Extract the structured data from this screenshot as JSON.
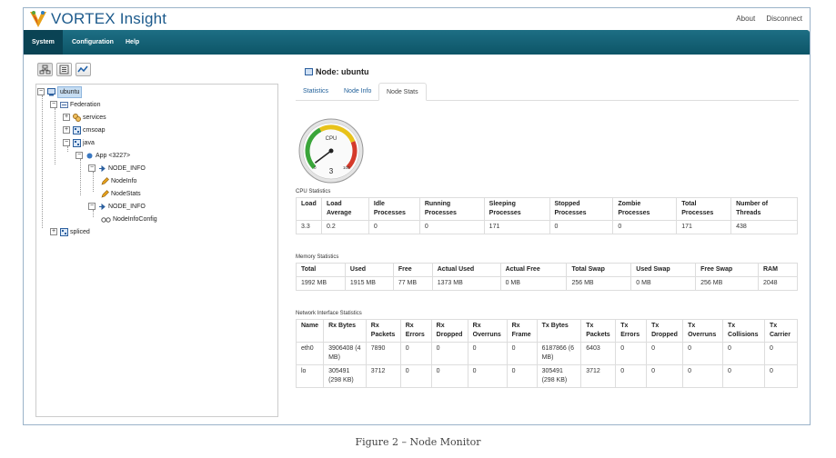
{
  "app": {
    "name": "VORTEX Insight"
  },
  "header": {
    "links": [
      "About",
      "Disconnect"
    ]
  },
  "nav": {
    "items": [
      "System",
      "Configuration",
      "Help"
    ],
    "active": "System"
  },
  "tree_toolbar": {
    "buttons": [
      "tree-view-icon",
      "list-view-icon",
      "chart-view-icon"
    ]
  },
  "tree": {
    "nodes": [
      {
        "label": "ubuntu",
        "icon": "computer-icon",
        "toggle": "−",
        "selected": true
      },
      {
        "label": "Federation",
        "icon": "federation-icon",
        "toggle": "−"
      },
      {
        "label": "services",
        "icon": "services-icon",
        "toggle": "+"
      },
      {
        "label": "cmsoap",
        "icon": "process-icon",
        "toggle": "+"
      },
      {
        "label": "java",
        "icon": "process-icon",
        "toggle": "−"
      },
      {
        "label": "App <3227>",
        "icon": "app-icon",
        "toggle": "−"
      },
      {
        "label": "NODE_INFO",
        "icon": "topic-icon",
        "toggle": "−"
      },
      {
        "label": "NodeInfo",
        "icon": "pencil-icon",
        "toggle": ""
      },
      {
        "label": "NodeStats",
        "icon": "pencil-icon",
        "toggle": ""
      },
      {
        "label": "NODE_INFO",
        "icon": "topic-icon",
        "toggle": "−"
      },
      {
        "label": "NodeInfoConfig",
        "icon": "glasses-icon",
        "toggle": ""
      },
      {
        "label": "spliced",
        "icon": "process-icon",
        "toggle": "+"
      }
    ]
  },
  "main": {
    "title": "Node: ubuntu",
    "tabs": [
      "Statistics",
      "Node Info",
      "Node Stats"
    ],
    "active_tab": "Node Stats",
    "gauge": {
      "label": "CPU",
      "value": "3",
      "min_label": "0",
      "max_label": "100",
      "level": 3
    },
    "cpu": {
      "label": "CPU Statistics",
      "headers": [
        "Load",
        "Load Average",
        "Idle Processes",
        "Running Processes",
        "Sleeping Processes",
        "Stopped Processes",
        "Zombie Processes",
        "Total Processes",
        "Number of Threads"
      ],
      "rows": [
        [
          "3.3",
          "0.2",
          "0",
          "0",
          "171",
          "0",
          "0",
          "171",
          "438"
        ]
      ]
    },
    "memory": {
      "label": "Memory Statistics",
      "headers": [
        "Total",
        "Used",
        "Free",
        "Actual Used",
        "Actual Free",
        "Total Swap",
        "Used Swap",
        "Free Swap",
        "RAM"
      ],
      "rows": [
        [
          "1992 MB",
          "1915 MB",
          "77 MB",
          "1373 MB",
          "0 MB",
          "256 MB",
          "0 MB",
          "256 MB",
          "2048"
        ]
      ]
    },
    "network": {
      "label": "Network Interface Statistics",
      "headers": [
        "Name",
        "Rx Bytes",
        "Rx Packets",
        "Rx Errors",
        "Rx Dropped",
        "Rx Overruns",
        "Rx Frame",
        "Tx Bytes",
        "Tx Packets",
        "Tx Errors",
        "Tx Dropped",
        "Tx Overruns",
        "Tx Collisions",
        "Tx Carrier"
      ],
      "rows": [
        [
          "eth0",
          "3906408 (4 MB)",
          "7890",
          "0",
          "0",
          "0",
          "0",
          "6187866 (6 MB)",
          "6403",
          "0",
          "0",
          "0",
          "0",
          "0"
        ],
        [
          "lo",
          "305491 (298 KB)",
          "3712",
          "0",
          "0",
          "0",
          "0",
          "305491 (298 KB)",
          "3712",
          "0",
          "0",
          "0",
          "0",
          "0"
        ]
      ]
    }
  },
  "caption": "Figure 2 – Node Monitor"
}
